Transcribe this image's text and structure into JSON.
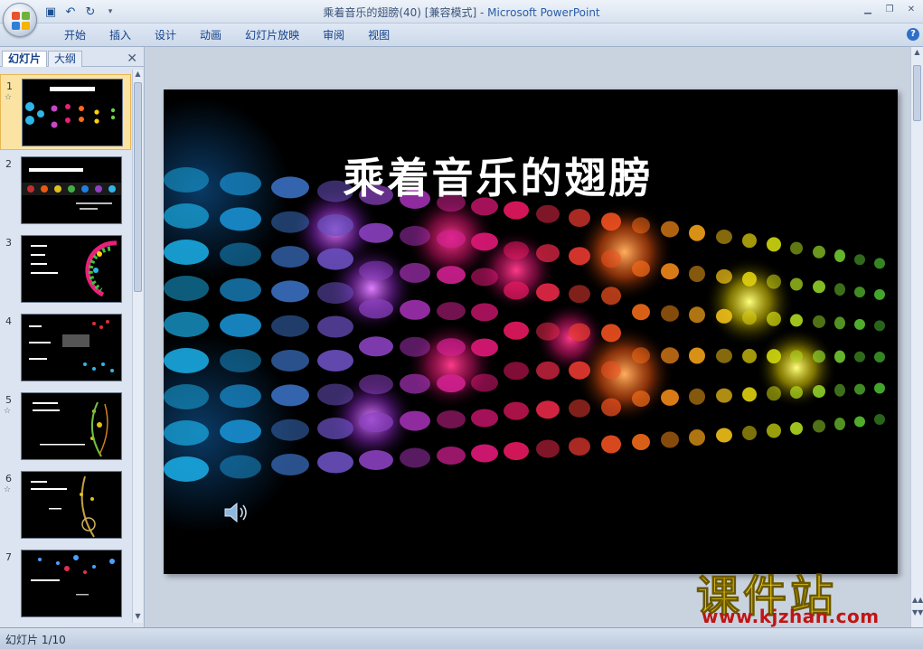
{
  "window": {
    "title_doc": "乘着音乐的翅膀(40) [兼容模式]",
    "title_sep": " - ",
    "title_app": "Microsoft PowerPoint"
  },
  "qat": {
    "save_icon": "save-icon",
    "undo_icon": "undo-icon",
    "redo_icon": "redo-icon"
  },
  "ribbon": {
    "tabs": [
      "开始",
      "插入",
      "设计",
      "动画",
      "幻灯片放映",
      "审阅",
      "视图"
    ]
  },
  "leftpane": {
    "tab_slides": "幻灯片",
    "tab_outline": "大纲",
    "slides": [
      {
        "num": "1",
        "star": "☆"
      },
      {
        "num": "2",
        "star": ""
      },
      {
        "num": "3",
        "star": ""
      },
      {
        "num": "4",
        "star": ""
      },
      {
        "num": "5",
        "star": "☆"
      },
      {
        "num": "6",
        "star": "☆"
      },
      {
        "num": "7",
        "star": ""
      }
    ]
  },
  "slide": {
    "title": "乘着音乐的翅膀"
  },
  "watermark": {
    "brand": "课件站",
    "url": "www.kjzhan.com"
  },
  "status": {
    "text": "幻灯片 1/10"
  },
  "colors": {
    "accent": "#2b5ca8",
    "selected_thumb": "#fbe3a3"
  }
}
